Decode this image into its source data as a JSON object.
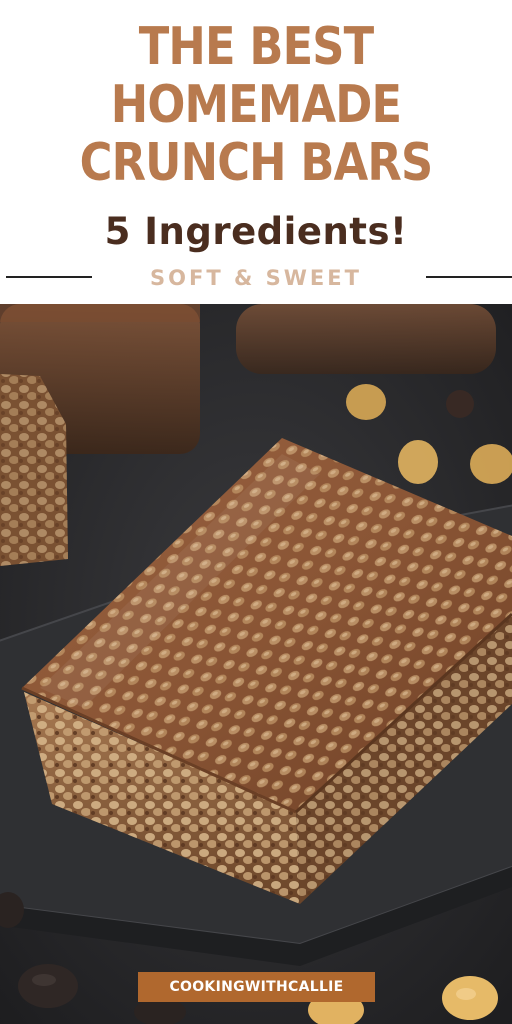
{
  "header": {
    "title_lines": [
      "THE BEST",
      "HOMEMADE",
      "CRUNCH BARS"
    ],
    "subtitle": "5 Ingredients!",
    "tagline": "SOFT & SWEET"
  },
  "brand": {
    "label": "COOKINGWITHCALLIE"
  },
  "colors": {
    "title": "#b87a4e",
    "subtitle": "#4a2d1f",
    "tagline": "#d7b79e",
    "brand_bar": "#b0682e",
    "slate": "#2c2d30",
    "chocolate": "#8a5535"
  }
}
